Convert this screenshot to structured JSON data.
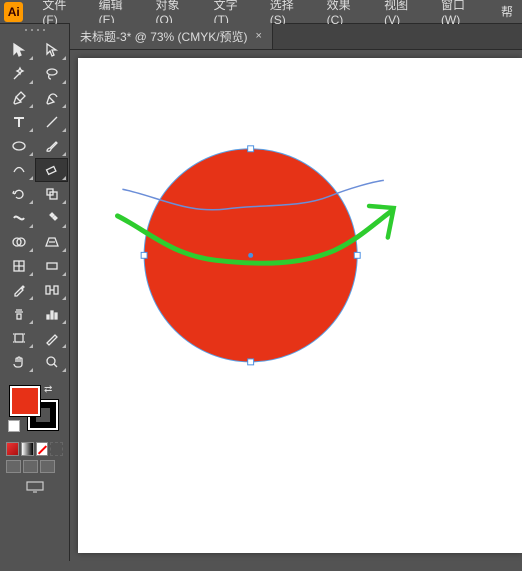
{
  "logo": "Ai",
  "menu": {
    "file": "文件(F)",
    "edit": "编辑(E)",
    "object": "对象(O)",
    "text": "文字(T)",
    "select": "选择(S)",
    "effect": "效果(C)",
    "view": "视图(V)",
    "window": "窗口(W)",
    "help": "帮"
  },
  "tab": {
    "title": "未标题-3* @ 73% (CMYK/预览)",
    "close": "×"
  },
  "colors": {
    "fill": "#e73117",
    "stroke": "#000000",
    "circle": "#e63317",
    "bluePath": "#6b8ed8",
    "greenPath": "#2ecc2e"
  }
}
